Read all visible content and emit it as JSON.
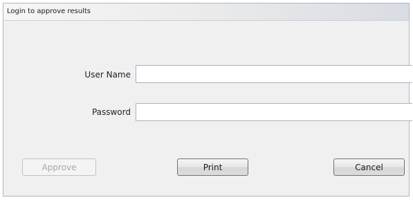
{
  "window": {
    "title": "Login to approve results"
  },
  "form": {
    "username_label": "User Name",
    "username_value": "",
    "password_label": "Password",
    "password_value": ""
  },
  "buttons": {
    "approve_label": "Approve",
    "approve_enabled": false,
    "print_label": "Print",
    "cancel_label": "Cancel"
  },
  "colors": {
    "window_background": "#f0f0f0",
    "field_border": "#a6b1c2",
    "disabled_text": "#a7a7a7"
  }
}
